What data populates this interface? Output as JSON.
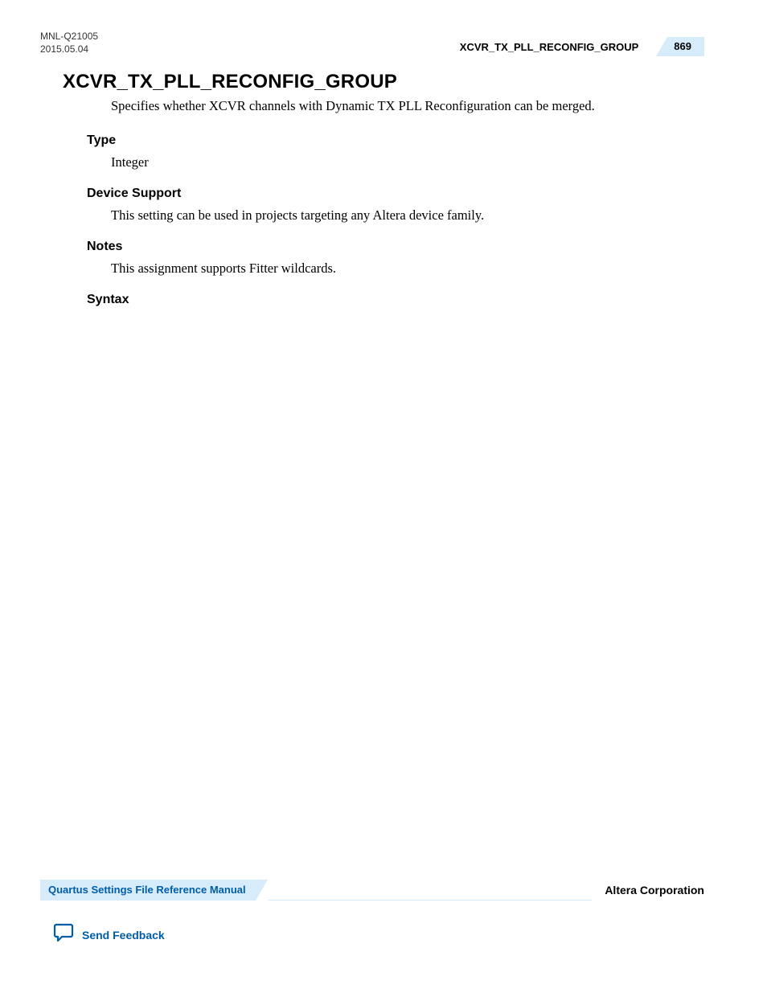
{
  "header": {
    "doc_id": "MNL-Q21005",
    "date": "2015.05.04",
    "topright_title": "XCVR_TX_PLL_RECONFIG_GROUP",
    "page_number": "869"
  },
  "main": {
    "title": "XCVR_TX_PLL_RECONFIG_GROUP",
    "intro": "Specifies whether XCVR channels with Dynamic TX PLL Reconfiguration can be merged.",
    "sections": {
      "type_head": "Type",
      "type_body": "Integer",
      "device_head": "Device Support",
      "device_body": "This setting can be used in projects targeting any Altera device family.",
      "notes_head": "Notes",
      "notes_body": "This assignment supports Fitter wildcards.",
      "syntax_head": "Syntax"
    }
  },
  "footer": {
    "manual_title": "Quartus Settings File Reference Manual",
    "corporation": "Altera Corporation",
    "feedback_label": "Send Feedback"
  }
}
